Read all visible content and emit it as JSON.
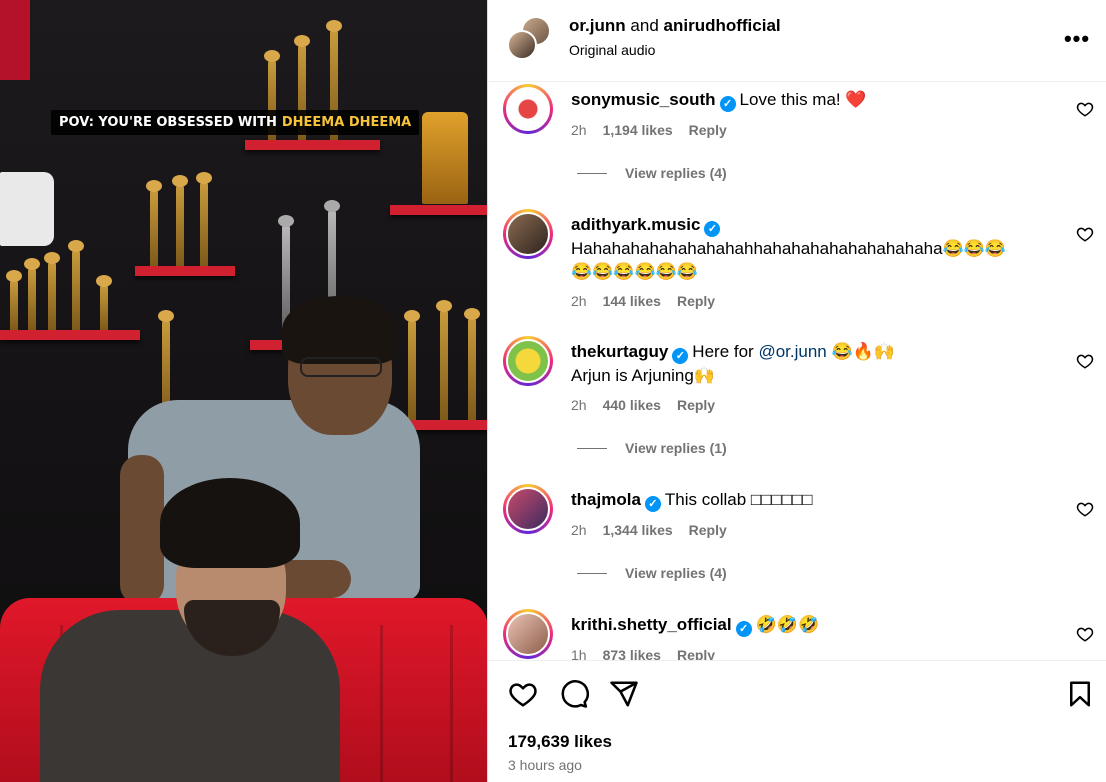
{
  "video": {
    "caption_prefix": "POV: YOU'RE OBSESSED WITH",
    "caption_highlight": "DHEEMA DHEEMA",
    "highlight_color": "#f5c43a"
  },
  "header": {
    "author_primary": "or.junn",
    "author_connector": "and",
    "author_secondary": "anirudhofficial",
    "subtitle": "Original audio",
    "more_icon": "more-dots-icon"
  },
  "comments": [
    {
      "user": "sonymusic_south",
      "verified": true,
      "text": "Love this ma! ❤️",
      "time": "2h",
      "likes": "1,194 likes",
      "reply": "Reply",
      "view_replies": "View replies (4)"
    },
    {
      "user": "adithyark.music",
      "verified": true,
      "text_line1": "Hahahahahahahahahahhahahahahahahahahaha😂😂😂",
      "text_line2": "😂😂😂😂😂😂",
      "time": "2h",
      "likes": "144 likes",
      "reply": "Reply"
    },
    {
      "user": "thekurtaguy",
      "verified": true,
      "text_pre": "Here for",
      "mention": "@or.junn",
      "text_post": "😂🔥🙌",
      "text_line2": "Arjun is Arjuning🙌",
      "time": "2h",
      "likes": "440 likes",
      "reply": "Reply",
      "view_replies": "View replies (1)"
    },
    {
      "user": "thajmola",
      "verified": true,
      "text": "This collab □□□□□□",
      "time": "2h",
      "likes": "1,344 likes",
      "reply": "Reply",
      "view_replies": "View replies (4)"
    },
    {
      "user": "krithi.shetty_official",
      "verified": true,
      "text": "🤣🤣🤣",
      "time": "1h",
      "likes": "873 likes",
      "reply": "Reply"
    }
  ],
  "footer": {
    "likes": "179,639 likes",
    "time_ago": "3 hours ago"
  },
  "colors": {
    "verified": "#0095f6",
    "muted_text": "#737373",
    "mention": "#00376b",
    "heart_red": "#e0182a"
  }
}
